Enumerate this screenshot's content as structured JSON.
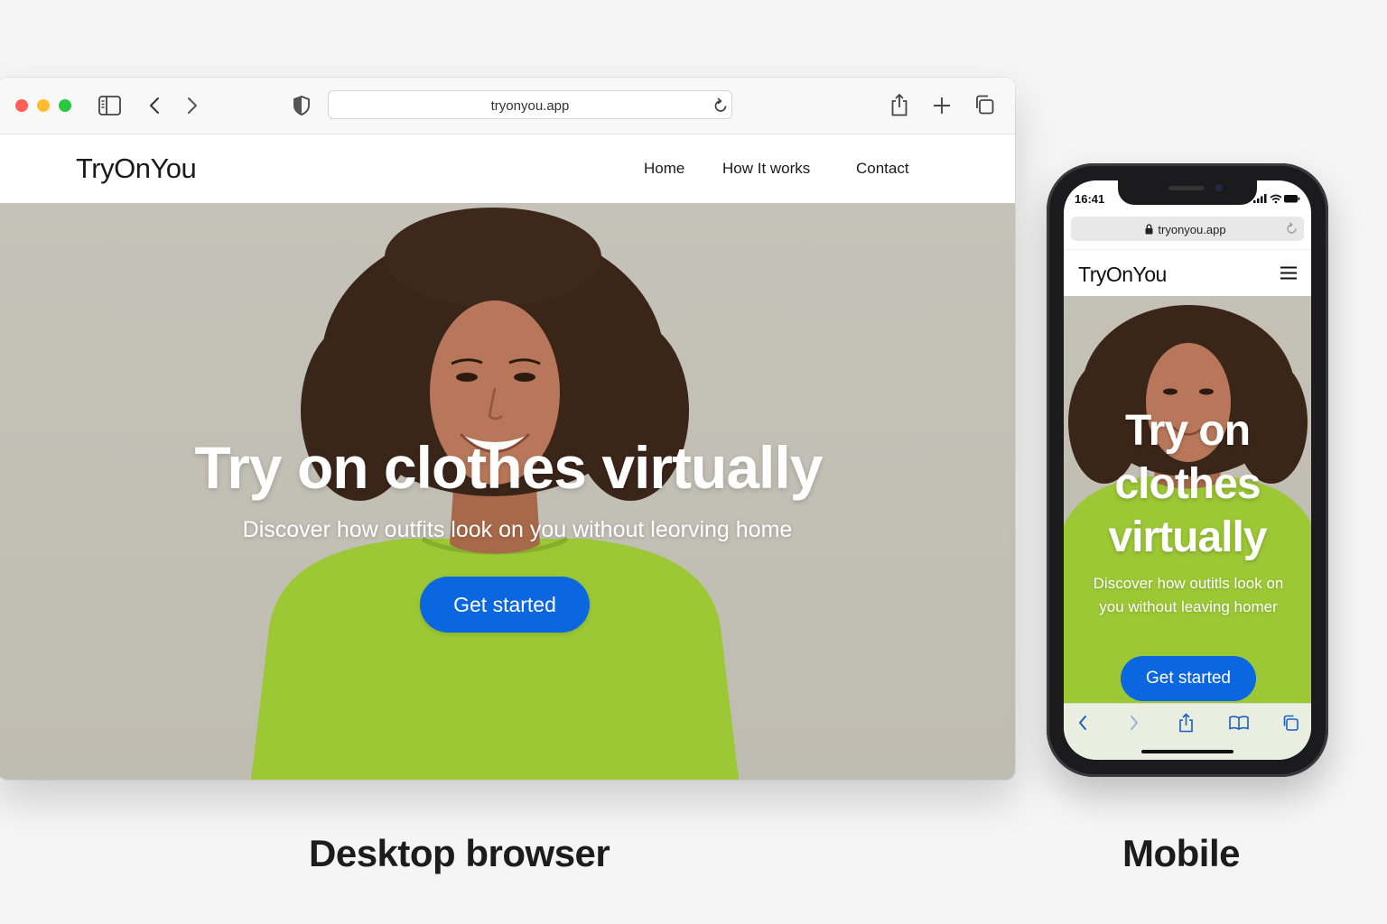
{
  "desktop": {
    "browser": {
      "address": "tryonyou.app",
      "icons": [
        "sidebar-icon",
        "back-icon",
        "forward-icon",
        "shield-icon",
        "reload-icon",
        "share-icon",
        "new-tab-icon",
        "tabs-icon"
      ]
    },
    "site": {
      "logo": "TryOnYou",
      "nav": [
        "Home",
        "How It works",
        "Contact"
      ],
      "hero": {
        "title": "Try on clothes virtually",
        "subtitle": "Discover how outfits look on you without leorving home",
        "cta": "Get started"
      }
    },
    "caption": "Desktop browser"
  },
  "mobile": {
    "status_time": "16:41",
    "address": "tryonyou.app",
    "site": {
      "logo": "TryOnYou",
      "hero": {
        "title": "Try on clothes virtually",
        "subtitle": "Discover how outitls look on you without leaving homer",
        "cta": "Get started"
      }
    },
    "toolbar_icons": [
      "back-icon",
      "forward-icon",
      "share-icon",
      "bookmarks-icon",
      "tabs-icon"
    ],
    "caption": "Mobile"
  },
  "colors": {
    "accent": "#0b67e0",
    "sweater": "#9cc836",
    "hero_background": "#c4c1b6"
  }
}
